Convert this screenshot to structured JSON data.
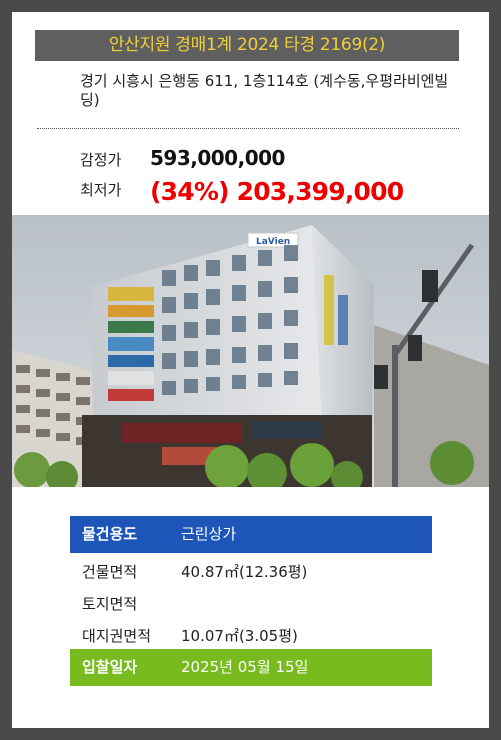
{
  "header": {
    "title": "안산지원 경매1계 2024 타경 2169(2)"
  },
  "address": "경기 시흥시 은행동 611, 1층114호 (계수동,우평라비엔빌딩)",
  "prices": {
    "appraisal_label": "감정가",
    "appraisal_value": "593,000,000",
    "minimum_label": "최저가",
    "minimum_value": "(34%) 203,399,000"
  },
  "photo": {
    "sign_text": "LaVien"
  },
  "details": {
    "usage_label": "물건용도",
    "usage_value": "근린상가",
    "building_area_label": "건물면적",
    "building_area_value": "40.87㎡(12.36평)",
    "land_area_label": "토지면적",
    "land_area_value": "",
    "land_right_label": "대지권면적",
    "land_right_value": "10.07㎡(3.05평)",
    "bid_date_label": "입찰일자",
    "bid_date_value": "2025년 05월 15일"
  },
  "colors": {
    "background": "#4a4a4a",
    "title_bar": "#5f5f5f",
    "title_text": "#f2cf3a",
    "min_price": "#ee0000",
    "usage_row": "#1e55b8",
    "bid_row": "#78bb1e"
  }
}
